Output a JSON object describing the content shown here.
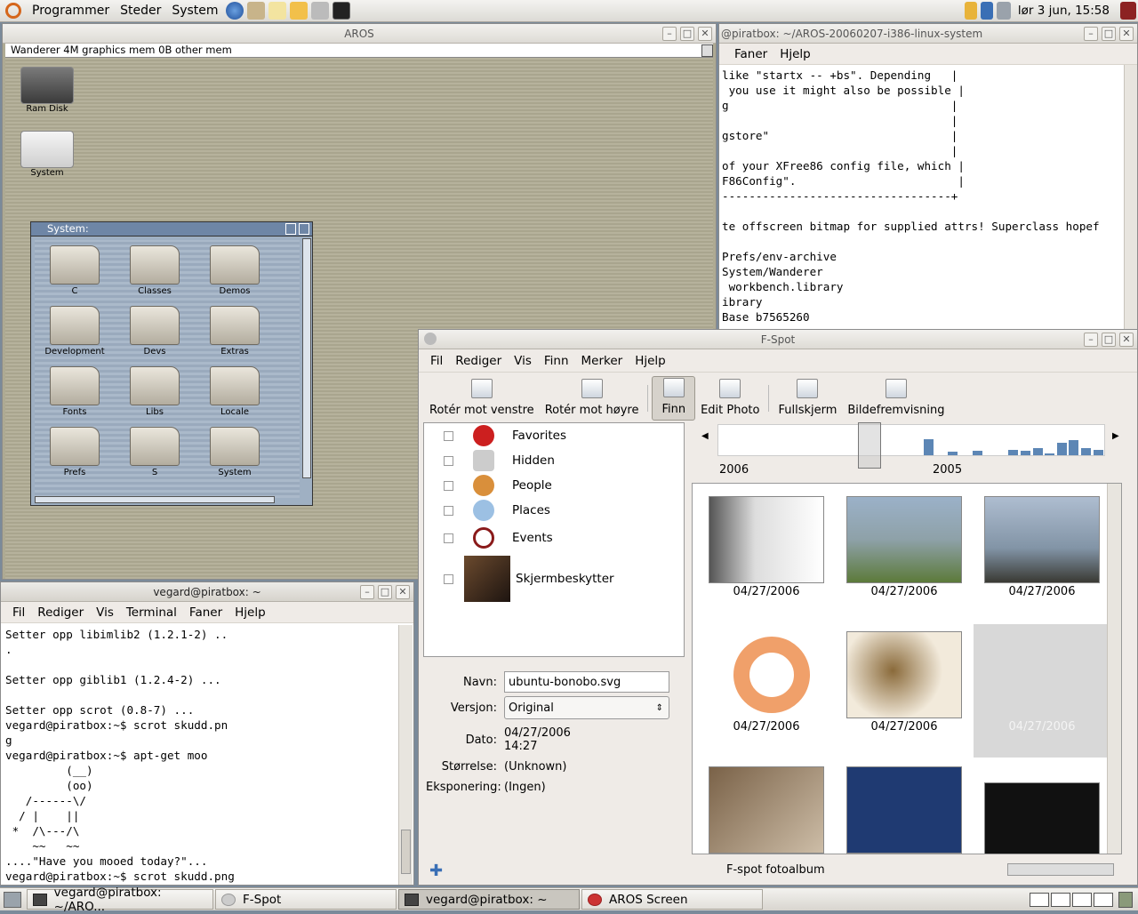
{
  "top_panel": {
    "menus": [
      "Programmer",
      "Steder",
      "System"
    ],
    "clock": "lør  3 jun, 15:58"
  },
  "aros": {
    "title": "AROS",
    "status": "Wanderer 4M graphics mem 0B other mem",
    "desktop_icons": [
      "Ram Disk",
      "System"
    ],
    "system_window": {
      "title": "System:",
      "folders": [
        "C",
        "Classes",
        "Demos",
        "Development",
        "Devs",
        "Extras",
        "Fonts",
        "Libs",
        "Locale",
        "Prefs",
        "S",
        "System"
      ]
    }
  },
  "right_terminal": {
    "title": "@piratbox: ~/AROS-20060207-i386-linux-system",
    "menus": [
      "Faner",
      "Hjelp"
    ],
    "lines": [
      "like \"startx -- +bs\". Depending   |",
      " you use it might also be possible |",
      "g                                 |",
      "                                  |",
      "gstore\"                           |",
      "                                  |",
      "of your XFree86 config file, which |",
      "F86Config\".                        |",
      "----------------------------------+",
      "",
      "te offscreen bitmap for supplied attrs! Superclass hopef",
      "",
      "Prefs/env-archive",
      "System/Wanderer",
      " workbench.library",
      "ibrary",
      "Base b7565260"
    ]
  },
  "bottom_terminal": {
    "title": "vegard@piratbox: ~",
    "menus": [
      "Fil",
      "Rediger",
      "Vis",
      "Terminal",
      "Faner",
      "Hjelp"
    ],
    "lines": [
      "Setter opp libimlib2 (1.2.1-2) ..",
      ".",
      "",
      "Setter opp giblib1 (1.2.4-2) ...",
      "",
      "Setter opp scrot (0.8-7) ...",
      "vegard@piratbox:~$ scrot skudd.pn",
      "g",
      "vegard@piratbox:~$ apt-get moo",
      "         (__)",
      "         (oo)",
      "   /------\\/",
      "  / |    ||",
      " *  /\\---/\\",
      "    ~~   ~~",
      "....\"Have you mooed today?\"...",
      "vegard@piratbox:~$ scrot skudd.png"
    ]
  },
  "fspot": {
    "title": "F-Spot",
    "menus": [
      "Fil",
      "Rediger",
      "Vis",
      "Finn",
      "Merker",
      "Hjelp"
    ],
    "toolbar": [
      "Rotér mot venstre",
      "Rotér mot høyre",
      "Finn",
      "Edit Photo",
      "Fullskjerm",
      "Bildefremvisning"
    ],
    "tags": [
      "Favorites",
      "Hidden",
      "People",
      "Places",
      "Events",
      "Skjermbeskytter"
    ],
    "timeline": {
      "start": "2006",
      "end": "2005"
    },
    "info": {
      "name_label": "Navn:",
      "name_value": "ubuntu-bonobo.svg",
      "version_label": "Versjon:",
      "version_value": "Original",
      "date_label": "Dato:",
      "date_value": "04/27/2006",
      "time_value": "14:27",
      "size_label": "Størrelse:",
      "size_value": "(Unknown)",
      "exposure_label": "Eksponering:",
      "exposure_value": "(Ingen)"
    },
    "photo_dates": [
      "04/27/2006",
      "04/27/2006",
      "04/27/2006",
      "04/27/2006",
      "04/27/2006",
      "04/27/2006"
    ],
    "status": "F-spot fotoalbum"
  },
  "taskbar": {
    "tasks": [
      "vegard@piratbox: ~/ARO...",
      "F-Spot",
      "vegard@piratbox: ~",
      "AROS Screen"
    ]
  }
}
